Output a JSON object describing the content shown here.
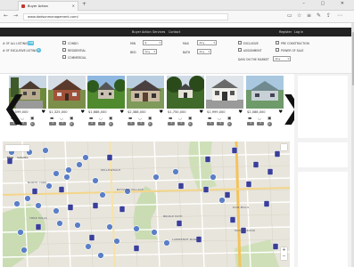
{
  "browser": {
    "tab_title": "Buyer Action",
    "url": "www.dodsonmanagement.com/",
    "new_tab_symbol": "+",
    "win_controls": "– ▢ ✕"
  },
  "site_nav": {
    "items": [
      "Buyer Action",
      "Services",
      "Contact"
    ],
    "right_items": [
      "Register",
      "Log In"
    ]
  },
  "filters": {
    "all_listings_label": "# OF ALL LISTINGS",
    "all_listings_count": "198",
    "exclusive_listings_label": "# OF EXCLUSIVE LISTINGS",
    "exclusive_listings_count": "5",
    "property_types": [
      "CONDO",
      "RESIDENTIAL",
      "COMMERCIAL"
    ],
    "min_label": "MIN",
    "min_value": "$",
    "max_label": "MAX",
    "max_value": "Any",
    "bed_label": "BED",
    "bed_value": "Any",
    "bath_label": "BATH",
    "bath_value": "Any",
    "status_col1": [
      "EXCLUSIVE",
      "ASSIGNMENT"
    ],
    "status_col2": [
      "PRE CONSTRUCTION",
      "POWER OF SALE"
    ],
    "days_label": "DAYS ON THE MARKET",
    "days_value": "Any"
  },
  "listings": [
    {
      "price": "$1,599,000",
      "beds": "3",
      "baths": "2",
      "parking": "1"
    },
    {
      "price": "$1,325,000",
      "beds": "4",
      "baths": "3",
      "parking": "2"
    },
    {
      "price": "$1,688,000",
      "beds": "4",
      "baths": "3",
      "parking": "2"
    },
    {
      "price": "$2,388,000",
      "beds": "5",
      "baths": "4",
      "parking": "2"
    },
    {
      "price": "$1,750,000",
      "beds": "3",
      "baths": "3",
      "parking": "2"
    },
    {
      "price": "$1,999,000",
      "beds": "5",
      "baths": "4",
      "parking": "2"
    },
    {
      "price": "$2,088,000",
      "beds": "4",
      "baths": "4",
      "parking": "2"
    }
  ],
  "carousel": {
    "prev": "❮",
    "next": "❯"
  },
  "map": {
    "tab_map": "Map",
    "tab_satellite": "Satellite",
    "zoom_in": "+",
    "zoom_out": "−",
    "places": [
      "NORTH YORK",
      "WILLOWDALE",
      "BAYVIEW VILLAGE",
      "DON MILLS",
      "BRIDLE PATH",
      "YORK MILLS",
      "LAWRENCE MANOR",
      "SUNNYBROOK"
    ]
  },
  "colors": {
    "marker_blue": "#5b7fc7",
    "marker_navy": "#3a3f9a",
    "badge": "#5bc0de",
    "nav_bg": "#222222"
  }
}
